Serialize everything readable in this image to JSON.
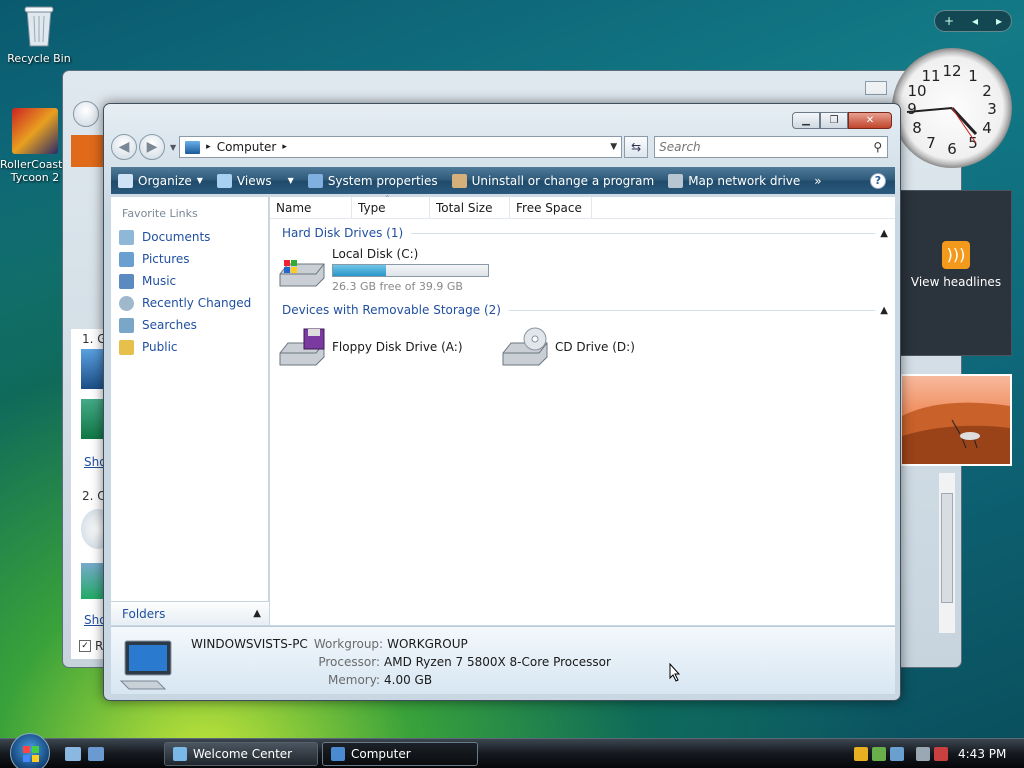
{
  "desktop": {
    "icons": [
      {
        "label": "Recycle Bin"
      },
      {
        "label": "RollerCoaster Tycoon 2"
      }
    ]
  },
  "background_window": {
    "fragments": [
      "1. G",
      "Sho",
      "2. O",
      "Sho",
      "R"
    ]
  },
  "gadgets": {
    "toolbar": {
      "add": "+",
      "prev": "◂",
      "next": "▸"
    },
    "clock": {
      "numbers": [
        "12",
        "1",
        "2",
        "3",
        "4",
        "5",
        "6",
        "7",
        "8",
        "9",
        "10",
        "11"
      ]
    },
    "feed": {
      "label": "View headlines"
    }
  },
  "window": {
    "caption": {
      "minimize": "▁",
      "maximize": "❐",
      "close": "✕"
    },
    "address": {
      "crumb": "Computer",
      "separator": "▸"
    },
    "search": {
      "placeholder": "Search"
    },
    "commands": [
      {
        "label": "Organize",
        "dropdown": true,
        "color": "#cfe3f5"
      },
      {
        "label": "Views",
        "dropdown": true,
        "color": "#a8d0f0"
      },
      {
        "label": "System properties",
        "dropdown": false,
        "color": "#7fb0e0"
      },
      {
        "label": "Uninstall or change a program",
        "dropdown": false,
        "color": "#d6b07a"
      },
      {
        "label": "Map network drive",
        "dropdown": false,
        "color": "#b8c6d2"
      }
    ],
    "more": "»",
    "help": "?",
    "favorite_links": {
      "header": "Favorite Links",
      "items": [
        {
          "label": "Documents",
          "color": "#8fb8d8"
        },
        {
          "label": "Pictures",
          "color": "#6aa0d0"
        },
        {
          "label": "Music",
          "color": "#5a8ac0"
        },
        {
          "label": "Recently Changed",
          "color": "#a0b8cc"
        },
        {
          "label": "Searches",
          "color": "#7aa6c8"
        },
        {
          "label": "Public",
          "color": "#e6c04a"
        }
      ]
    },
    "folders": {
      "label": "Folders",
      "chevron": "▲"
    },
    "columns": [
      "Name",
      "Type",
      "Total Size",
      "Free Space"
    ],
    "groups": {
      "hdd": {
        "label": "Hard Disk Drives (1)",
        "drives": [
          {
            "name": "Local Disk (C:)",
            "free_text": "26.3 GB free of 39.9 GB",
            "used_fraction": 0.34
          }
        ]
      },
      "removable": {
        "label": "Devices with Removable Storage (2)",
        "drives": [
          {
            "name": "Floppy Disk Drive (A:)"
          },
          {
            "name": "CD Drive (D:)"
          }
        ]
      }
    },
    "details": {
      "computer_name": "WINDOWSVISTS-PC",
      "workgroup_label": "Workgroup:",
      "workgroup": "WORKGROUP",
      "processor_label": "Processor:",
      "processor": "AMD Ryzen 7 5800X 8-Core Processor",
      "memory_label": "Memory:",
      "memory": "4.00 GB"
    }
  },
  "taskbar": {
    "buttons": [
      {
        "label": "Welcome Center",
        "active": false
      },
      {
        "label": "Computer",
        "active": true
      }
    ],
    "clock": "4:43 PM"
  }
}
